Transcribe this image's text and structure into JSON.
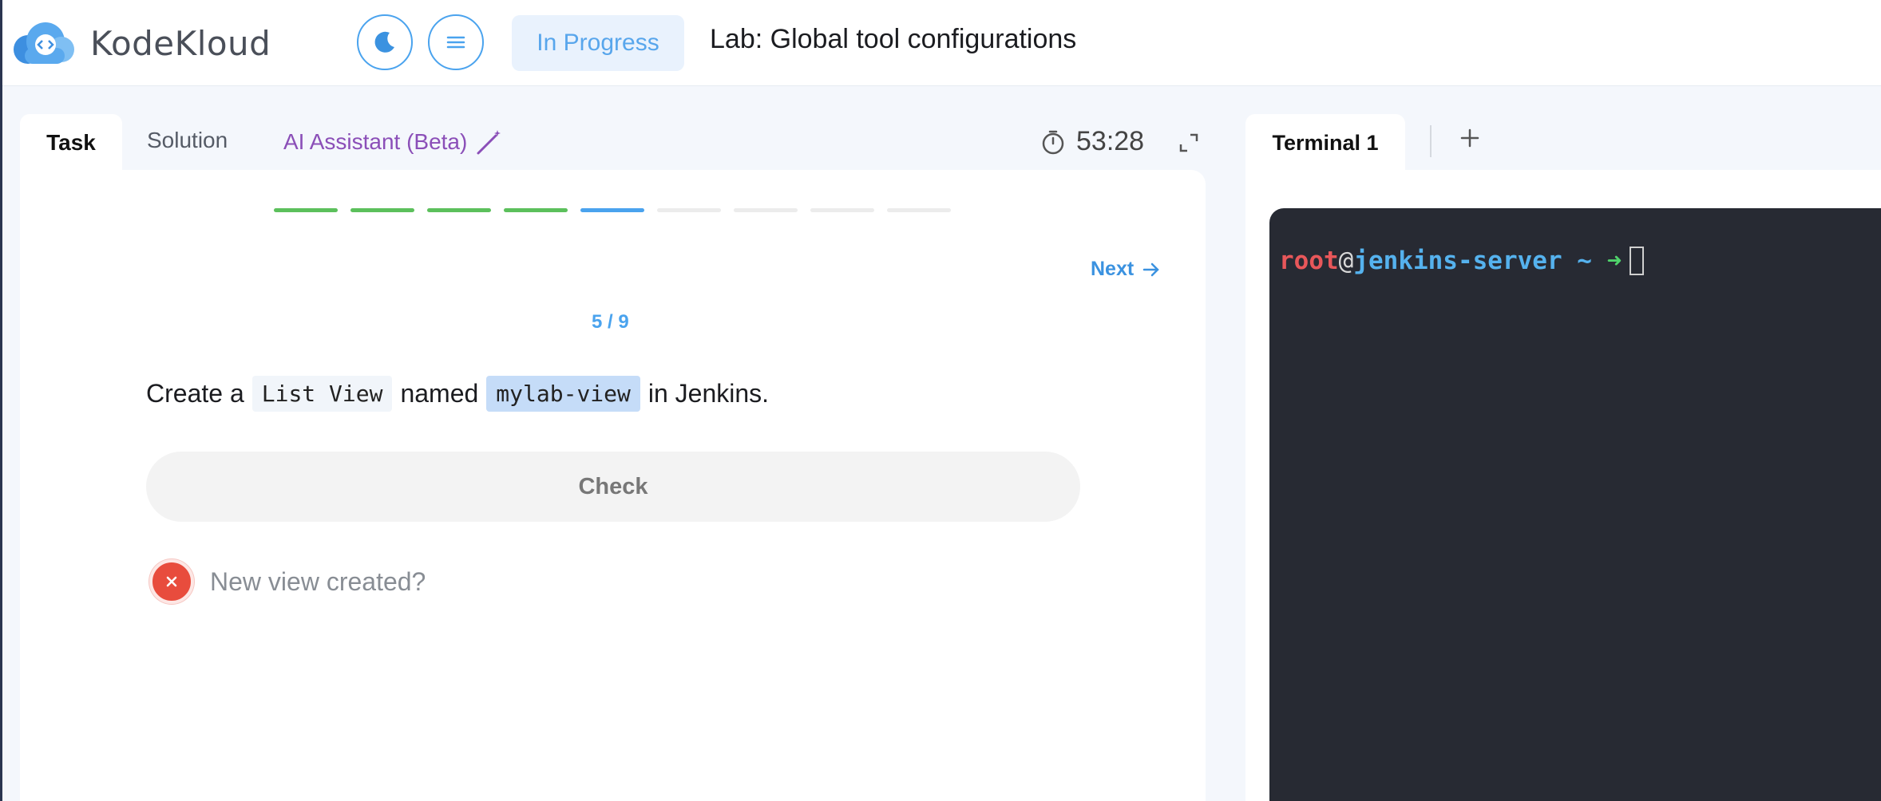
{
  "header": {
    "brand": "KodeKloud",
    "status_label": "In Progress",
    "lab_title": "Lab: Global tool configurations"
  },
  "tabs": {
    "task": "Task",
    "solution": "Solution",
    "ai_assistant": "AI Assistant (Beta)"
  },
  "timer": "53:28",
  "progress": {
    "completed": 4,
    "current": 5,
    "total": 9
  },
  "task": {
    "next_label": "Next",
    "step_counter": "5 / 9",
    "text_before": "Create a",
    "code_1": "List View",
    "text_middle": "named",
    "code_2": "mylab-view",
    "text_after": "in Jenkins.",
    "check_label": "Check",
    "result_text": "New view created?"
  },
  "terminal": {
    "tab_label": "Terminal 1",
    "user": "root",
    "at": "@",
    "host": "jenkins-server",
    "tilde": " ~ ",
    "arrow": "➜"
  },
  "colors": {
    "accent_blue": "#4aa3ee",
    "progress_done": "#5cc05c",
    "ai_purple": "#8b4fb8",
    "fail_red": "#e84c3d",
    "terminal_bg": "#272a33"
  }
}
